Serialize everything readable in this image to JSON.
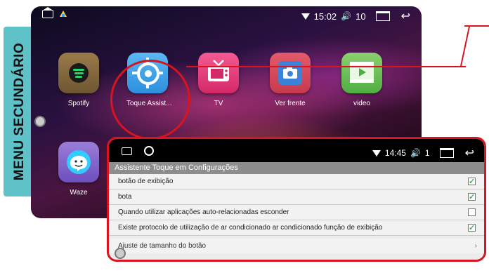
{
  "side_label": "MENU SECUNDÁRIO",
  "home": {
    "status": {
      "time": "15:02",
      "volume": "10"
    },
    "apps": [
      {
        "label": "Spotify",
        "icon": "spotify-icon"
      },
      {
        "label": "Toque Assist...",
        "icon": "crosshair-icon"
      },
      {
        "label": "TV",
        "icon": "tv-icon"
      },
      {
        "label": "Ver frente",
        "icon": "camera-icon"
      },
      {
        "label": "video",
        "icon": "video-icon"
      },
      {
        "label": "Waze",
        "icon": "waze-icon"
      }
    ]
  },
  "panel": {
    "status": {
      "time": "14:45",
      "volume": "1"
    },
    "title": "Assistente Toque em Configurações",
    "rows": [
      {
        "label": "botão de exibição",
        "checked": true
      },
      {
        "label": "bota",
        "checked": true
      },
      {
        "label": "Quando utilizar aplicações auto-relacionadas esconder",
        "checked": false
      },
      {
        "label": "Existe protocolo de utilização de ar condicionado ar condicionado função de exibição",
        "checked": true
      }
    ],
    "adjust_label": "Ajuste de tamanho do botão"
  },
  "colors": {
    "accent_red": "#d7141f",
    "side_label_bg": "#5fc2c9",
    "check_green": "#4caf50"
  }
}
